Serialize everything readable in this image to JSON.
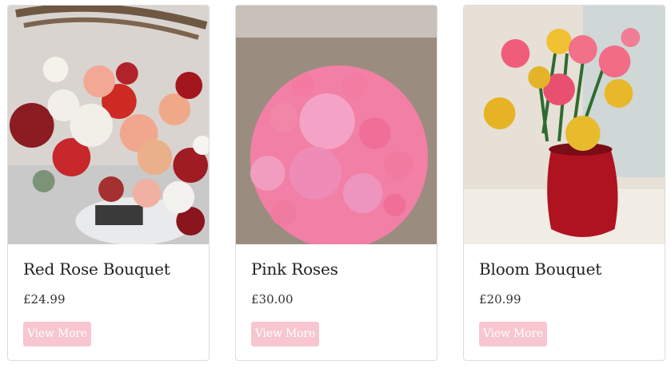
{
  "currency": "£",
  "colors": {
    "button_bg": "#f7c6d0",
    "button_text": "#ffffff",
    "card_border": "#dcdcdc"
  },
  "products": [
    {
      "name": "Red Rose Bouquet",
      "price": "£24.99",
      "button": "View More"
    },
    {
      "name": "Pink Roses",
      "price": "£30.00",
      "button": "View More"
    },
    {
      "name": "Bloom Bouquet",
      "price": "£20.99",
      "button": "View More"
    }
  ]
}
